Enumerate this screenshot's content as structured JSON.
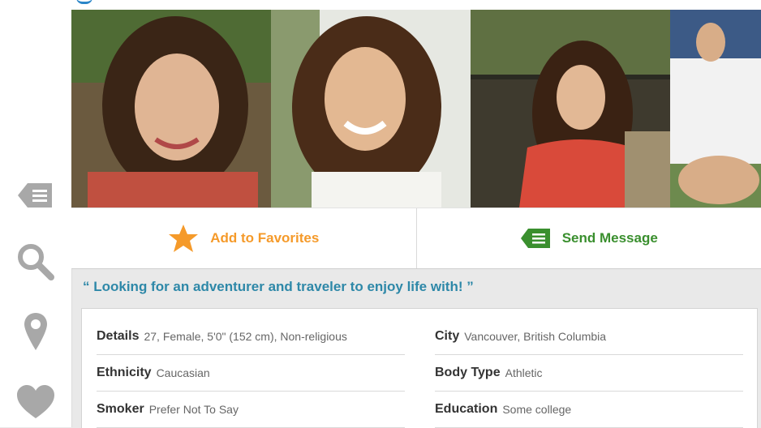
{
  "actions": {
    "favorites_label": "Add to Favorites",
    "message_label": "Send Message"
  },
  "profile": {
    "tagline": "“ Looking for an adventurer and traveler to enjoy life with! ”",
    "details": {
      "left": [
        {
          "label": "Details",
          "value": "27, Female, 5'0\" (152 cm), Non-religious"
        },
        {
          "label": "Ethnicity",
          "value": "Caucasian"
        },
        {
          "label": "Smoker",
          "value": "Prefer Not To Say"
        }
      ],
      "right": [
        {
          "label": "City",
          "value": "Vancouver, British Columbia"
        },
        {
          "label": "Body Type",
          "value": "Athletic"
        },
        {
          "label": "Education",
          "value": "Some college"
        }
      ]
    }
  },
  "colors": {
    "favorites": "#f59a2a",
    "message": "#3a8f2e",
    "tagline": "#2e88a8",
    "sidebar_icon": "#a8a8a8"
  },
  "icons": [
    "messages-icon",
    "search-icon",
    "location-pin-icon",
    "heart-icon",
    "star-icon",
    "message-bubble-icon"
  ]
}
